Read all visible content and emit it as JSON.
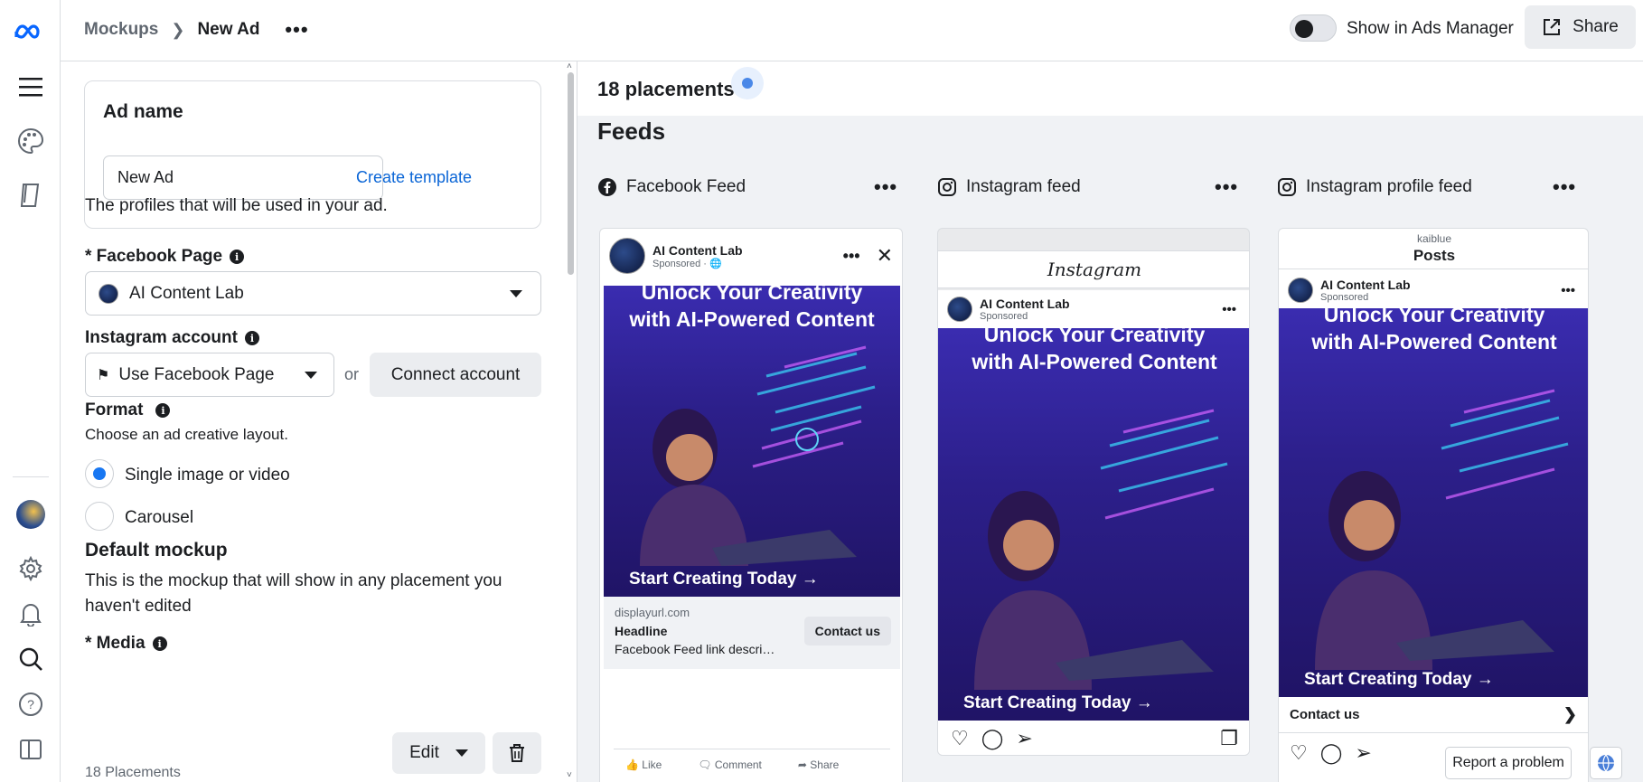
{
  "topbar": {
    "breadcrumb_root": "Mockups",
    "breadcrumb_current": "New Ad",
    "more_label": "•••",
    "toggle_label": "Show in Ads Manager",
    "share_label": "Share"
  },
  "rail": {
    "icons": [
      "meta-logo-icon",
      "menu-icon",
      "palette-icon",
      "book-icon",
      "avatar",
      "settings-icon",
      "bell-icon",
      "search-icon",
      "help-icon",
      "panel-toggle-icon"
    ]
  },
  "editor": {
    "ad_name_heading": "Ad name",
    "ad_name_value": "New Ad",
    "create_template": "Create template",
    "profiles_text": "The profiles that will be used in your ad.",
    "facebook_page_label": "* Facebook Page",
    "facebook_page_value": "AI Content Lab",
    "instagram_label": "Instagram account",
    "instagram_value": "Use Facebook Page",
    "or_text": "or",
    "connect_account": "Connect account",
    "format_label": "Format",
    "format_sub": "Choose an ad creative layout.",
    "format_options": [
      {
        "label": "Single image or video",
        "selected": true
      },
      {
        "label": "Carousel",
        "selected": false
      }
    ],
    "default_mockup_heading": "Default mockup",
    "default_mockup_text": "This is the mockup that will show in any placement you haven't edited",
    "media_label": "* Media",
    "media_sub": "18 Placements",
    "edit_label": "Edit"
  },
  "preview": {
    "placements_count": "18 placements",
    "section_title": "Feeds",
    "columns": [
      {
        "title": "Facebook Feed",
        "icon": "facebook-icon"
      },
      {
        "title": "Instagram feed",
        "icon": "instagram-icon"
      },
      {
        "title": "Instagram profile feed",
        "icon": "instagram-icon"
      }
    ],
    "ad": {
      "page_name": "AI Content Lab",
      "sponsored": "Sponsored · ",
      "sponsored_plain": "Sponsored",
      "headline_line1": "Unlock Your Creativity",
      "headline_line2": "with AI-Powered Content",
      "cta_image": "Start Creating Today →",
      "display_url": "displayurl.com",
      "headline": "Headline",
      "link_desc": "Facebook Feed link descri…",
      "contact_btn": "Contact us",
      "like": "Like",
      "comment": "Comment",
      "share": "Share"
    },
    "instagram_brand": "Instagram",
    "profile_user": "kaiblue",
    "profile_posts": "Posts",
    "profile_contact": "Contact us",
    "report_problem": "Report a problem"
  },
  "colors": {
    "accent": "#1877f2",
    "link": "#0a65d6",
    "creative_bg": "#2c1f8a"
  }
}
